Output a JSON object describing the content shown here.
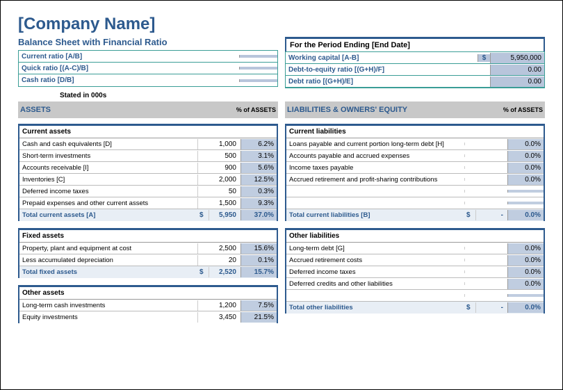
{
  "title": "[Company Name]",
  "subtitle": "Balance Sheet with Financial Ratio",
  "period_header": "For the Period Ending [End Date]",
  "stated": "Stated in 000s",
  "ratios_left": [
    {
      "label": "Current ratio [A/B]",
      "val": ""
    },
    {
      "label": "Quick ratio [(A-C)/B]",
      "val": ""
    },
    {
      "label": "Cash ratio [D/B]",
      "val": ""
    }
  ],
  "ratios_right": [
    {
      "label": "Working capital [A-B]",
      "dollar": "$",
      "val": "5,950,000"
    },
    {
      "label": "Debt-to-equity ratio [(G+H)/F]",
      "dollar": "",
      "val": "0.00"
    },
    {
      "label": "Debt ratio [(G+H)/E]",
      "dollar": "",
      "val": "0.00"
    }
  ],
  "left_hdr": {
    "title": "ASSETS",
    "pct": "% of ASSETS"
  },
  "right_hdr": {
    "title": "LIABILITIES & OWNERS' EQUITY",
    "pct": "% of ASSETS"
  },
  "current_assets": {
    "header": "Current assets",
    "rows": [
      {
        "label": "Cash and cash equivalents [D]",
        "val": "1,000",
        "pct": "6.2%"
      },
      {
        "label": "Short-term investments",
        "val": "500",
        "pct": "3.1%"
      },
      {
        "label": "Accounts receivable [I]",
        "val": "900",
        "pct": "5.6%"
      },
      {
        "label": "Inventories [C]",
        "val": "2,000",
        "pct": "12.5%"
      },
      {
        "label": "Deferred income taxes",
        "val": "50",
        "pct": "0.3%"
      },
      {
        "label": "Prepaid expenses and other current assets",
        "val": "1,500",
        "pct": "9.3%"
      }
    ],
    "total": {
      "label": "Total current assets [A]",
      "dollar": "$",
      "val": "5,950",
      "pct": "37.0%"
    }
  },
  "fixed_assets": {
    "header": "Fixed assets",
    "rows": [
      {
        "label": "Property, plant and equipment at cost",
        "val": "2,500",
        "pct": "15.6%"
      },
      {
        "label": "Less accumulated depreciation",
        "val": "20",
        "pct": "0.1%"
      }
    ],
    "total": {
      "label": "Total fixed assets",
      "dollar": "$",
      "val": "2,520",
      "pct": "15.7%"
    }
  },
  "other_assets": {
    "header": "Other assets",
    "rows": [
      {
        "label": "Long-term cash investments",
        "val": "1,200",
        "pct": "7.5%"
      },
      {
        "label": "Equity investments",
        "val": "3,450",
        "pct": "21.5%"
      }
    ]
  },
  "current_liab": {
    "header": "Current liabilities",
    "rows": [
      {
        "label": "Loans payable and current portion long-term debt [H]",
        "val": "",
        "pct": "0.0%"
      },
      {
        "label": "Accounts payable and accrued expenses",
        "val": "",
        "pct": "0.0%"
      },
      {
        "label": "Income taxes payable",
        "val": "",
        "pct": "0.0%"
      },
      {
        "label": "Accrued retirement and profit-sharing contributions",
        "val": "",
        "pct": "0.0%"
      }
    ],
    "empty_rows": 2,
    "total": {
      "label": "Total current liabilities [B]",
      "dollar": "$",
      "val": "-",
      "pct": "0.0%"
    }
  },
  "other_liab": {
    "header": "Other liabilities",
    "rows": [
      {
        "label": "Long-term debt [G]",
        "val": "",
        "pct": "0.0%"
      },
      {
        "label": "Accrued retirement costs",
        "val": "",
        "pct": "0.0%"
      },
      {
        "label": "Deferred income taxes",
        "val": "",
        "pct": "0.0%"
      },
      {
        "label": "Deferred credits and other liabilities",
        "val": "",
        "pct": "0.0%"
      }
    ],
    "empty_rows": 1,
    "total": {
      "label": "Total other liabilities",
      "dollar": "$",
      "val": "-",
      "pct": "0.0%"
    }
  }
}
